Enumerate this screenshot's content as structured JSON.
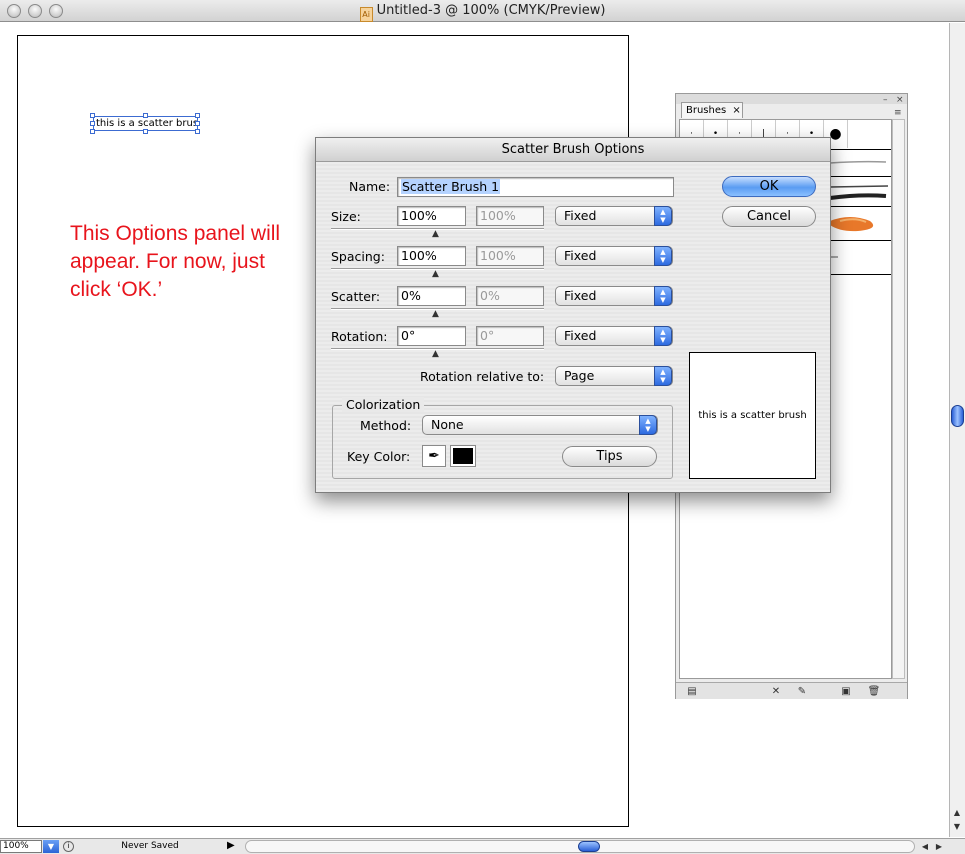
{
  "window": {
    "title": "Untitled-3 @ 100% (CMYK/Preview)",
    "doc_icon_glyph": "Ai"
  },
  "canvas": {
    "selected_text": "this is a scatter brush",
    "annotation": "This Options panel will appear. For now, just click ‘OK.’"
  },
  "statusbar": {
    "zoom": "100%",
    "status_text": "Never Saved"
  },
  "brushes_panel": {
    "tab_label": "Brushes",
    "tab_close": "×"
  },
  "dialog": {
    "title": "Scatter Brush Options",
    "name_label": "Name:",
    "name_value": "Scatter Brush 1",
    "ok_label": "OK",
    "cancel_label": "Cancel",
    "params": [
      {
        "label": "Size:",
        "value": "100%",
        "value2": "100%",
        "mode": "Fixed"
      },
      {
        "label": "Spacing:",
        "value": "100%",
        "value2": "100%",
        "mode": "Fixed"
      },
      {
        "label": "Scatter:",
        "value": "0%",
        "value2": "0%",
        "mode": "Fixed"
      },
      {
        "label": "Rotation:",
        "value": "0°",
        "value2": "0°",
        "mode": "Fixed"
      }
    ],
    "rotation_relative_label": "Rotation relative to:",
    "rotation_relative_value": "Page",
    "colorization": {
      "group_label": "Colorization",
      "method_label": "Method:",
      "method_value": "None",
      "key_color_label": "Key Color:",
      "key_color": "#000000",
      "tips_label": "Tips"
    },
    "preview_text": "this is a scatter brush"
  },
  "colors": {
    "accent": "#2d6ae0",
    "annotation": "#e8141c",
    "selection": "#3c6bd1"
  }
}
